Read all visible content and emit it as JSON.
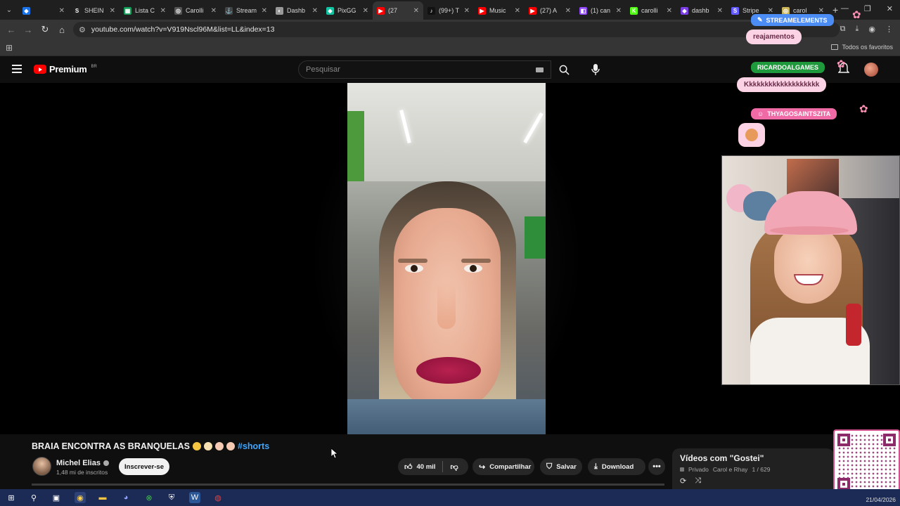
{
  "browser": {
    "tabs": [
      {
        "title": "",
        "fav_color": "#1a73e8",
        "fav_glyph": "◆",
        "active": false
      },
      {
        "title": "SHEIN",
        "fav_color": "#222222",
        "fav_glyph": "S",
        "active": false
      },
      {
        "title": "Lista C",
        "fav_color": "#0f9d58",
        "fav_glyph": "▦",
        "active": false
      },
      {
        "title": "Carolli",
        "fav_color": "#555555",
        "fav_glyph": "◎",
        "active": false
      },
      {
        "title": "Stream",
        "fav_color": "#444444",
        "fav_glyph": "⚓",
        "active": false
      },
      {
        "title": "Dashb",
        "fav_color": "#999999",
        "fav_glyph": "◐",
        "active": false
      },
      {
        "title": "PixGG",
        "fav_color": "#13c2a1",
        "fav_glyph": "◆",
        "active": false
      },
      {
        "title": "(27",
        "fav_color": "#ff0000",
        "fav_glyph": "▶",
        "active": true
      },
      {
        "title": "(99+) T",
        "fav_color": "#111111",
        "fav_glyph": "♪",
        "active": false
      },
      {
        "title": "Music",
        "fav_color": "#ff0000",
        "fav_glyph": "▶",
        "active": false
      },
      {
        "title": "(27) A",
        "fav_color": "#ff0000",
        "fav_glyph": "▶",
        "active": false
      },
      {
        "title": "(1) can",
        "fav_color": "#9146ff",
        "fav_glyph": "◧",
        "active": false
      },
      {
        "title": "carolli",
        "fav_color": "#53fc18",
        "fav_glyph": "K",
        "active": false
      },
      {
        "title": "dashb",
        "fav_color": "#7b3fe4",
        "fav_glyph": "◆",
        "active": false
      },
      {
        "title": "Stripe",
        "fav_color": "#635bff",
        "fav_glyph": "S",
        "active": false
      },
      {
        "title": "carol",
        "fav_color": "#c9b458",
        "fav_glyph": "◎",
        "active": false
      }
    ],
    "url": "youtube.com/watch?v=V919Nscl96M&list=LL&index=13",
    "bookmarks_folder": "Todos os favoritos"
  },
  "youtube": {
    "logo_text": "Premium",
    "country": "BR",
    "search_placeholder": "Pesquisar",
    "video": {
      "title": "BRAIA ENCONTRA AS BRANQUELAS",
      "hashtag": "#shorts",
      "channel": "Michel Elias",
      "subscribers": "1,48 mi de inscritos",
      "subscribe_label": "Inscrever-se",
      "likes": "40 mil",
      "share_label": "Compartilhar",
      "save_label": "Salvar",
      "download_label": "Download"
    },
    "playlist": {
      "title": "Vídeos com \"Gostei\"",
      "privacy": "Privado",
      "owner": "Carol e Rhay",
      "position": "1 / 629"
    }
  },
  "overlay": {
    "brand_badge": "STREAMELEMENTS",
    "messages": [
      {
        "user": "",
        "text": "reajamentos"
      },
      {
        "user": "RICARDOALGAMES",
        "text": "Kkkkkkkkkkkkkkkkkkk"
      },
      {
        "user": "THYAGOSAINTSZITA",
        "text": ""
      }
    ]
  },
  "taskbar": {
    "date": "21/04/2026"
  },
  "colors": {
    "yt_red": "#ff0000",
    "chat_bubble": "#fbd3e4",
    "chat_text": "#6a2a4a",
    "badge_blue": "#4b8df5",
    "badge_green": "#1e9a3c",
    "badge_pink": "#f06aa6",
    "link_blue": "#3ea6ff"
  }
}
